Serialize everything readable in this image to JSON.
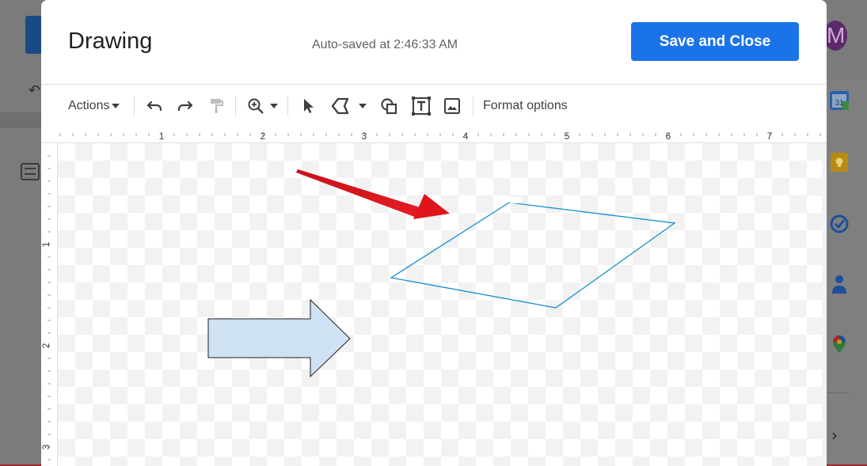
{
  "background": {
    "avatar_letter": "M",
    "calendar_day": "31"
  },
  "dialog": {
    "title": "Drawing",
    "autosave": "Auto-saved at 2:46:33 AM",
    "save_label": "Save and Close"
  },
  "toolbar": {
    "actions_label": "Actions",
    "format_options_label": "Format options"
  },
  "ruler": {
    "horizontal_labels": [
      "1",
      "2",
      "3",
      "4",
      "5",
      "6",
      "7"
    ],
    "vertical_labels": [
      "1",
      "2",
      "3"
    ]
  },
  "colors": {
    "accent": "#1a73e8",
    "selection_outline": "#1a8fd0",
    "block_arrow_fill": "#cfe2f3",
    "annotation_arrow": "#d9161c"
  },
  "icons": [
    "undo-icon",
    "redo-icon",
    "paint-format-icon",
    "zoom-icon",
    "select-icon",
    "line-icon",
    "shape-icon",
    "text-box-icon",
    "image-icon"
  ]
}
